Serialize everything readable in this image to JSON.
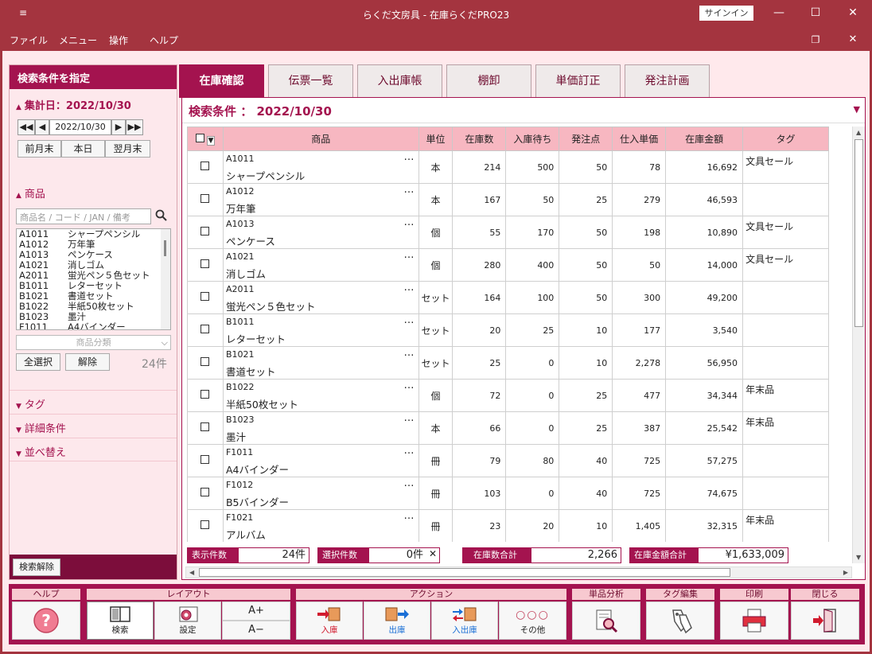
{
  "titlebar": {
    "sysmenu_icon": "≡",
    "title": "らくだ文房具 - 在庫らくだPRO23",
    "signin": "サインイン",
    "minimize": "—",
    "maximize": "☐",
    "close": "✕",
    "restore": "❐"
  },
  "menu": [
    "ファイル",
    "メニュー",
    "操作",
    "ヘルプ"
  ],
  "left": {
    "header": "検索条件を指定",
    "date_section": "集計日：2022/10/30",
    "date_value": "2022/10/30",
    "date_buttons": [
      "前月末",
      "本日",
      "翌月末"
    ],
    "product_section": "商品",
    "search_placeholder": "商品名 / コード / JAN / 備考",
    "product_list": [
      {
        "code": "A1011",
        "name": "シャープペンシル"
      },
      {
        "code": "A1012",
        "name": "万年筆"
      },
      {
        "code": "A1013",
        "name": "ペンケース"
      },
      {
        "code": "A1021",
        "name": "消しゴム"
      },
      {
        "code": "A2011",
        "name": "蛍光ペン５色セット"
      },
      {
        "code": "B1011",
        "name": "レターセット"
      },
      {
        "code": "B1021",
        "name": "書道セット"
      },
      {
        "code": "B1022",
        "name": "半紙50枚セット"
      },
      {
        "code": "B1023",
        "name": "墨汁"
      },
      {
        "code": "F1011",
        "name": "A4バインダー"
      }
    ],
    "category_placeholder": "商品分類",
    "select_all": "全選択",
    "clear": "解除",
    "count": "24件",
    "sections": [
      "タグ",
      "詳細条件",
      "並べ替え"
    ],
    "reset_button": "検索解除"
  },
  "tabs": [
    "在庫確認",
    "伝票一覧",
    "入出庫帳",
    "棚卸",
    "単価訂正",
    "発注計画"
  ],
  "active_tab": 0,
  "condition": "検索条件 ： 2022/10/30",
  "table": {
    "headers": [
      "商品",
      "単位",
      "在庫数",
      "入庫待ち",
      "発注点",
      "仕入単価",
      "在庫金額",
      "タグ"
    ],
    "rows": [
      {
        "code": "A1011",
        "name": "シャープペンシル",
        "unit": "本",
        "stock": "214",
        "incoming": "500",
        "order_point": "50",
        "unit_price": "78",
        "amount": "16,692",
        "tag": "文具セール"
      },
      {
        "code": "A1012",
        "name": "万年筆",
        "unit": "本",
        "stock": "167",
        "incoming": "50",
        "order_point": "25",
        "unit_price": "279",
        "amount": "46,593",
        "tag": ""
      },
      {
        "code": "A1013",
        "name": "ペンケース",
        "unit": "個",
        "stock": "55",
        "incoming": "170",
        "order_point": "50",
        "unit_price": "198",
        "amount": "10,890",
        "tag": "文具セール"
      },
      {
        "code": "A1021",
        "name": "消しゴム",
        "unit": "個",
        "stock": "280",
        "incoming": "400",
        "order_point": "50",
        "unit_price": "50",
        "amount": "14,000",
        "tag": "文具セール"
      },
      {
        "code": "A2011",
        "name": "蛍光ペン５色セット",
        "unit": "セット",
        "stock": "164",
        "incoming": "100",
        "order_point": "50",
        "unit_price": "300",
        "amount": "49,200",
        "tag": ""
      },
      {
        "code": "B1011",
        "name": "レターセット",
        "unit": "セット",
        "stock": "20",
        "incoming": "25",
        "order_point": "10",
        "unit_price": "177",
        "amount": "3,540",
        "tag": ""
      },
      {
        "code": "B1021",
        "name": "書道セット",
        "unit": "セット",
        "stock": "25",
        "incoming": "0",
        "order_point": "10",
        "unit_price": "2,278",
        "amount": "56,950",
        "tag": ""
      },
      {
        "code": "B1022",
        "name": "半紙50枚セット",
        "unit": "個",
        "stock": "72",
        "incoming": "0",
        "order_point": "25",
        "unit_price": "477",
        "amount": "34,344",
        "tag": "年末品"
      },
      {
        "code": "B1023",
        "name": "墨汁",
        "unit": "本",
        "stock": "66",
        "incoming": "0",
        "order_point": "25",
        "unit_price": "387",
        "amount": "25,542",
        "tag": "年末品"
      },
      {
        "code": "F1011",
        "name": "A4バインダー",
        "unit": "冊",
        "stock": "79",
        "incoming": "80",
        "order_point": "40",
        "unit_price": "725",
        "amount": "57,275",
        "tag": ""
      },
      {
        "code": "F1012",
        "name": "B5バインダー",
        "unit": "冊",
        "stock": "103",
        "incoming": "0",
        "order_point": "40",
        "unit_price": "725",
        "amount": "74,675",
        "tag": ""
      },
      {
        "code": "F1021",
        "name": "アルバム",
        "unit": "冊",
        "stock": "23",
        "incoming": "20",
        "order_point": "10",
        "unit_price": "1,405",
        "amount": "32,315",
        "tag": "年末品"
      }
    ]
  },
  "summary": {
    "shown_label": "表示件数",
    "shown_value": "24件",
    "selected_label": "選択件数",
    "selected_value": "0件",
    "stock_total_label": "在庫数合計",
    "stock_total_value": "2,266",
    "amount_total_label": "在庫金額合計",
    "amount_total_value": "¥1,633,009"
  },
  "toolbar": {
    "help": {
      "group": "ヘルプ"
    },
    "layout": {
      "group": "レイアウト",
      "search": "検索",
      "settings": "設定",
      "font_up": "A+",
      "font_down": "A−"
    },
    "action": {
      "group": "アクション",
      "in": "入庫",
      "out": "出庫",
      "inout": "入出庫",
      "other": "その他"
    },
    "analysis": {
      "group": "単品分析"
    },
    "tag_edit": {
      "group": "タグ編集"
    },
    "print": {
      "group": "印刷"
    },
    "close": {
      "group": "閉じる"
    }
  },
  "colors": {
    "accent": "#a4134f",
    "titlebar": "#a4343f",
    "header_bg": "#f7b7c1",
    "panel_bg": "#fde8ec"
  }
}
